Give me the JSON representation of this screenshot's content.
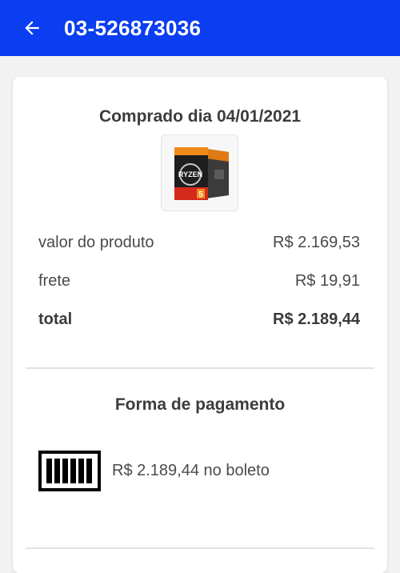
{
  "appbar": {
    "title": "03-526873036",
    "background": "#0a3ef0",
    "back_icon": "arrow-left-icon"
  },
  "purchase": {
    "date_label": "Comprado dia 04/01/2021",
    "product_image": "amd-ryzen-5-box"
  },
  "summary": {
    "rows": [
      {
        "label": "valor do produto",
        "value": "R$ 2.169,53"
      },
      {
        "label": "frete",
        "value": "R$ 19,91"
      },
      {
        "label": "total",
        "value": "R$ 2.189,44"
      }
    ]
  },
  "payment": {
    "title": "Forma de pagamento",
    "icon": "barcode-icon",
    "description": "R$ 2.189,44 no boleto"
  }
}
